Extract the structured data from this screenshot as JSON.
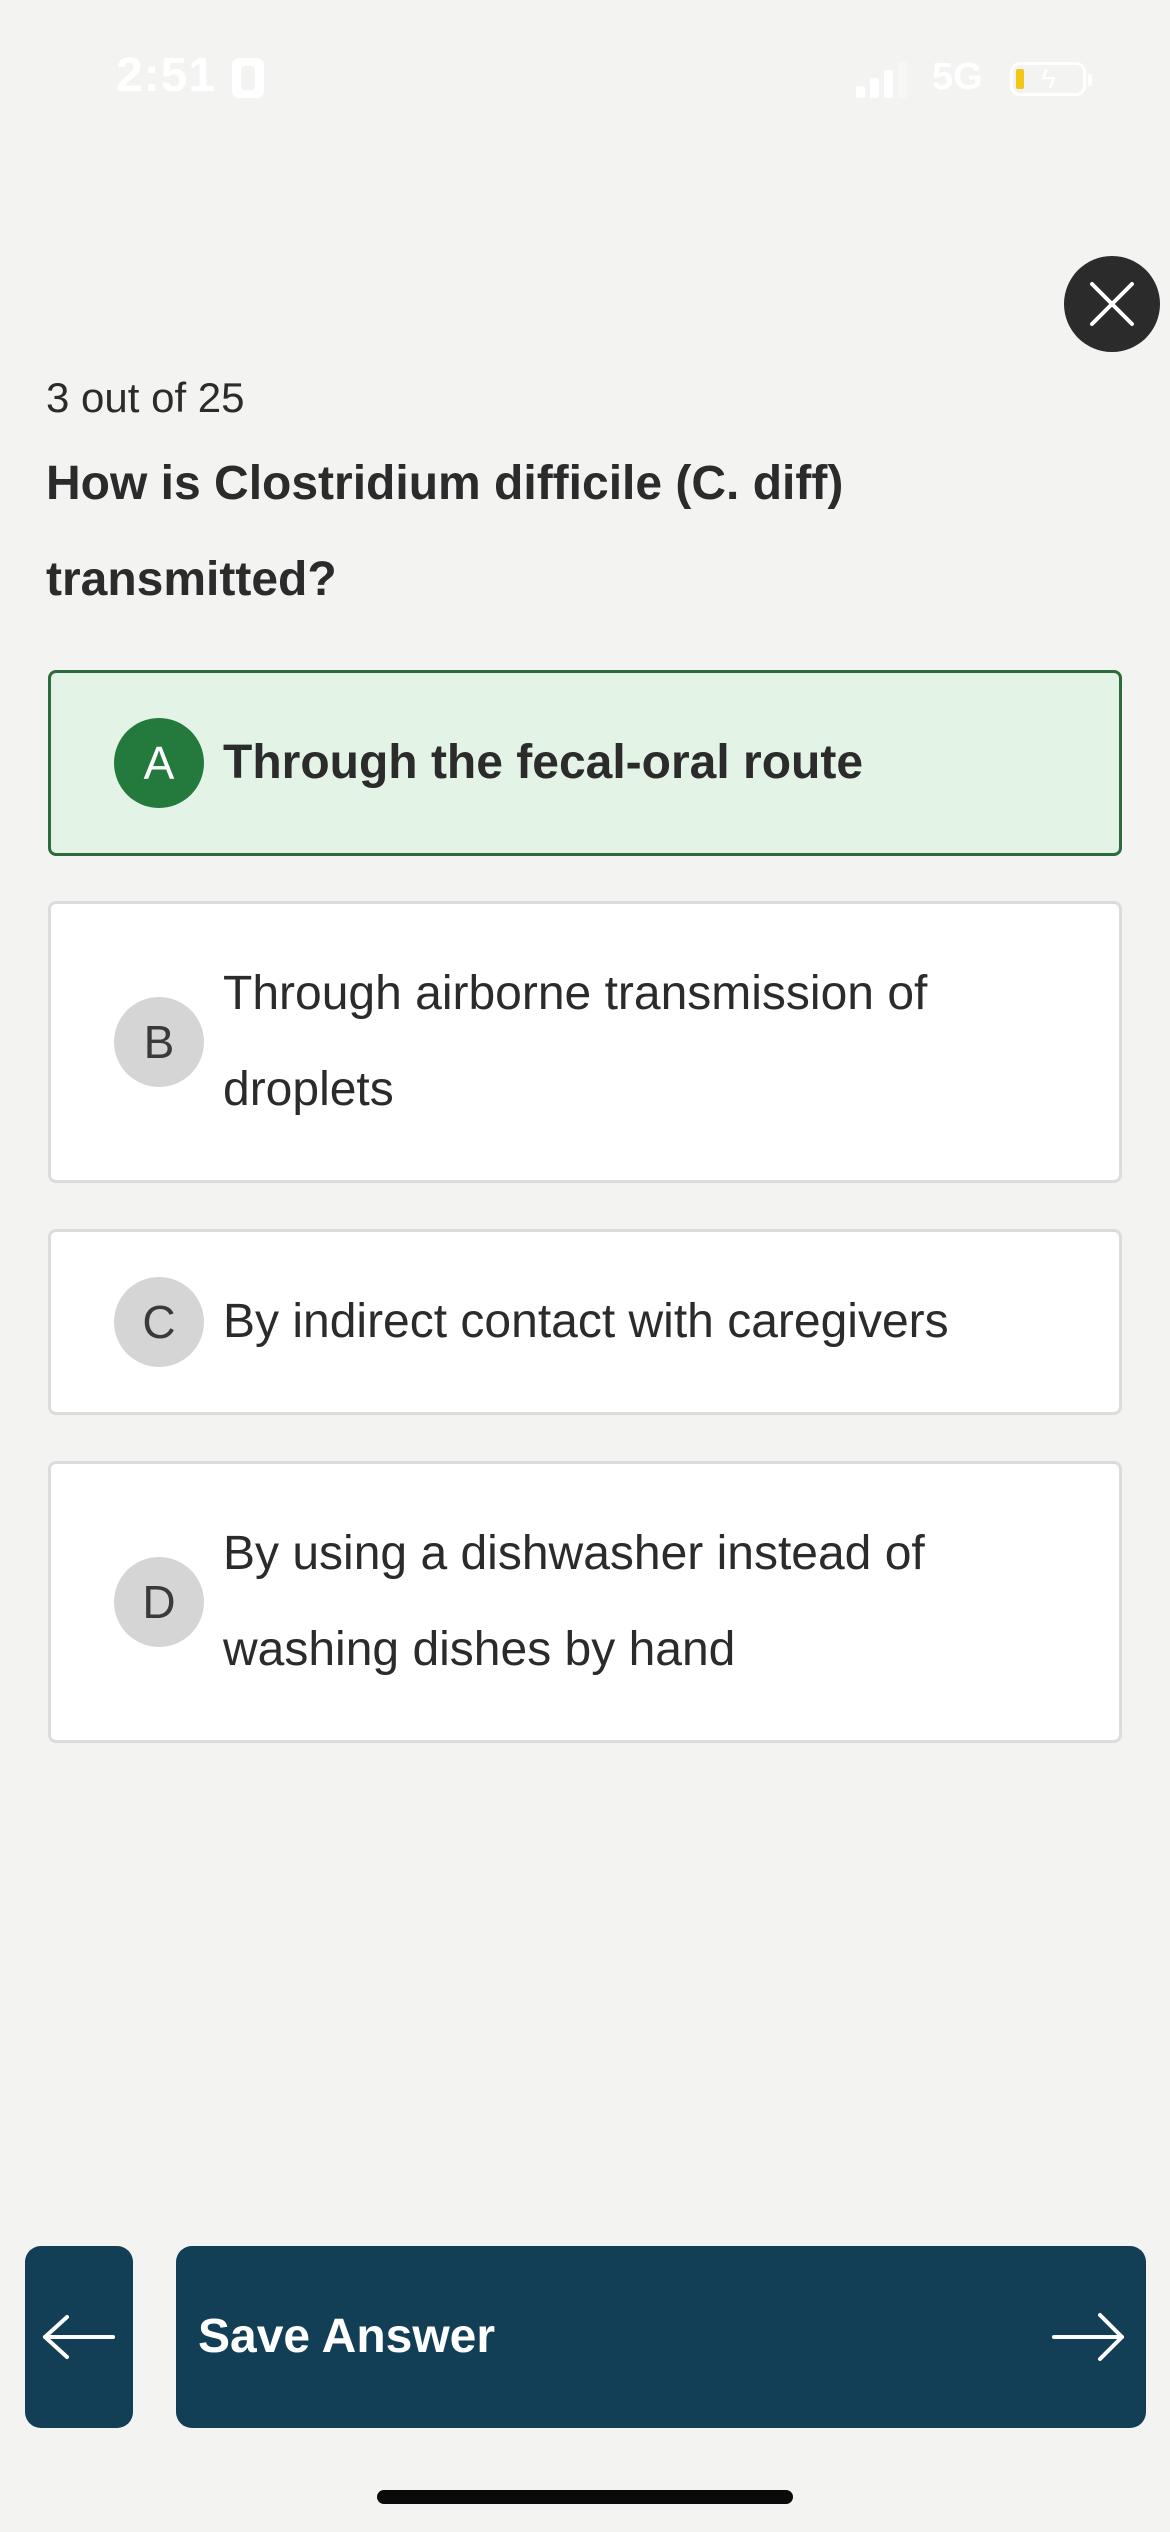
{
  "status_bar": {
    "time": "2:51",
    "network": "5G",
    "battery_level_fraction": 0.1,
    "battery_color": "#f5c518"
  },
  "quiz": {
    "progress_text": "3 out of 25",
    "question": "How is Clostridium difficile (C. diff) transmitted?",
    "options": [
      {
        "letter": "A",
        "text": "Through the fecal-oral route",
        "selected": true
      },
      {
        "letter": "B",
        "text": "Through airborne transmission of droplets",
        "selected": false
      },
      {
        "letter": "C",
        "text": "By indirect contact with caregivers",
        "selected": false
      },
      {
        "letter": "D",
        "text": "By using a dishwasher instead of washing dishes by hand",
        "selected": false
      }
    ]
  },
  "actions": {
    "save_label": "Save Answer"
  },
  "icons": {
    "close": "close-icon",
    "back": "arrow-left-icon",
    "next": "arrow-right-icon"
  },
  "colors": {
    "primary": "#123f56",
    "selected_bg": "#e3f4e6",
    "selected_border": "#2e6b3c",
    "selected_badge": "#237a3c"
  }
}
